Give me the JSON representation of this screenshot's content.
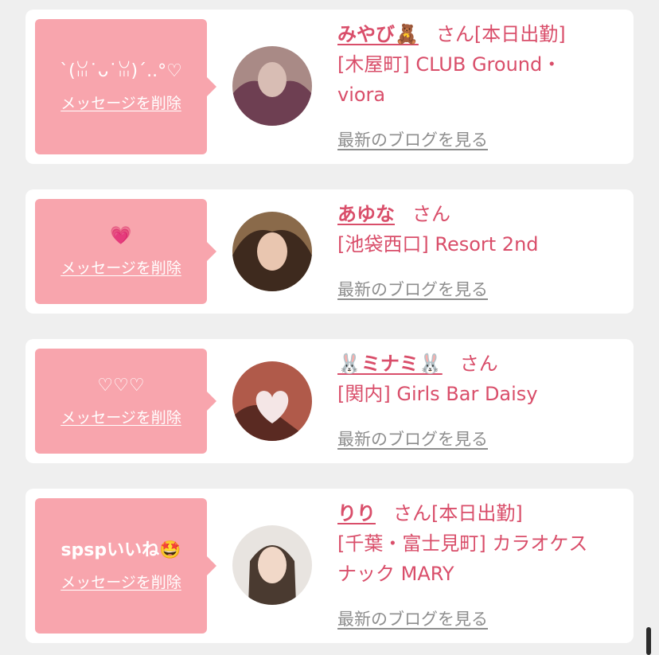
{
  "messages": [
    {
      "message": "`(ꈍ˙ᴗ˙ꈍ)´..°♡",
      "delete_label": "メッセージを削除",
      "name": "みやび🧸",
      "san": "さん",
      "status": "[本日出勤]",
      "shop_lines": [
        "[木屋町] CLUB Ground・",
        "viora"
      ],
      "blog_label": "最新のブログを見る",
      "avatar_colors": [
        "#a98a86",
        "#6e3f52",
        "#d8bdb4"
      ]
    },
    {
      "message": "💗",
      "delete_label": "メッセージを削除",
      "name": "あゆな",
      "san": "さん",
      "status": "",
      "shop_lines": [
        "[池袋西口] Resort 2nd"
      ],
      "blog_label": "最新のブログを見る",
      "avatar_colors": [
        "#8a6a4a",
        "#3e2a1e",
        "#e9c6b0"
      ]
    },
    {
      "message": "♡♡♡",
      "delete_label": "メッセージを削除",
      "name": "🐰ミナミ🐰",
      "san": "さん",
      "status": "",
      "shop_lines": [
        "[関内] Girls Bar Daisy"
      ],
      "blog_label": "最新のブログを見る",
      "avatar_colors": [
        "#b05a4a",
        "#5a2a22",
        "#f4e6e6"
      ]
    },
    {
      "message": "spspいいね🤩",
      "delete_label": "メッセージを削除",
      "name": "りり",
      "san": "さん",
      "status": "[本日出勤]",
      "shop_lines": [
        "[千葉・富士見町] カラオケス",
        "ナック MARY"
      ],
      "blog_label": "最新のブログを見る",
      "avatar_colors": [
        "#e8e4e0",
        "#4a3a30",
        "#f1d8c8"
      ]
    }
  ],
  "colors": {
    "accent": "#d94e6a",
    "bubble": "#f8a5ad",
    "background": "#efefef",
    "link_gray": "#8e8e8e"
  }
}
